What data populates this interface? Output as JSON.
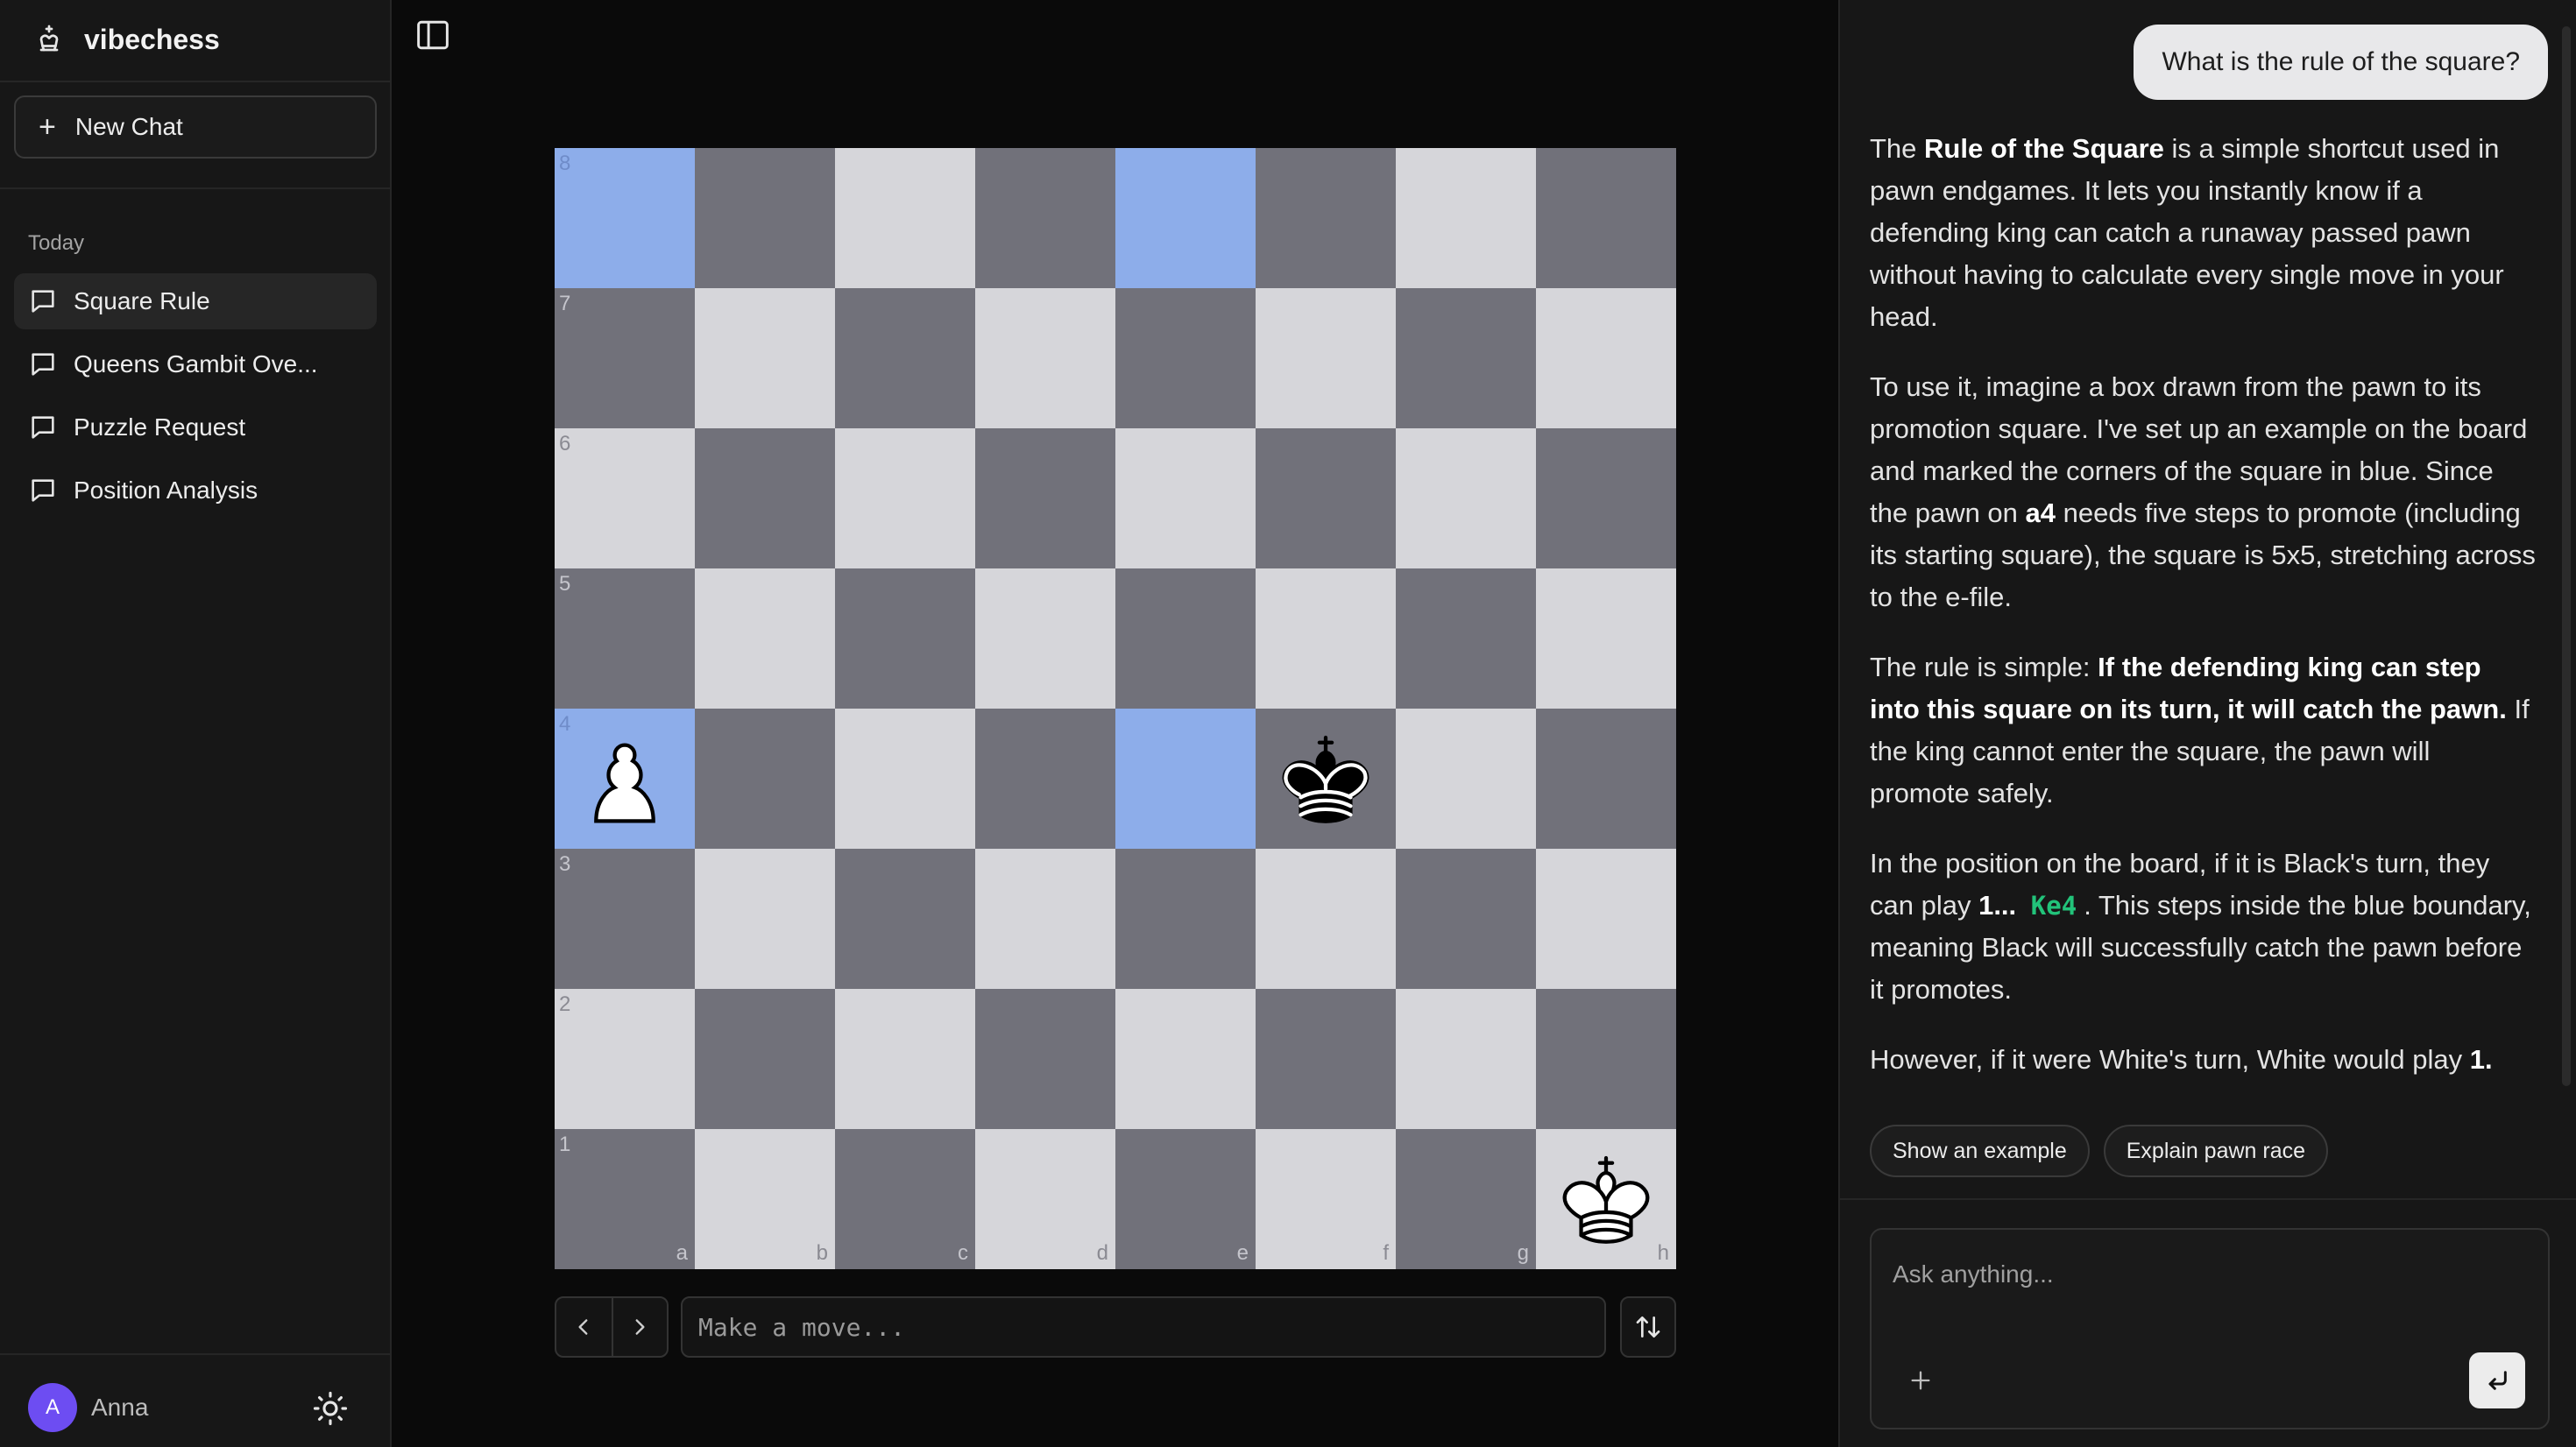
{
  "sidebar": {
    "brand": "vibechess",
    "new_chat": "New Chat",
    "section_label": "Today",
    "chats": [
      {
        "label": "Square Rule",
        "active": true
      },
      {
        "label": "Queens Gambit Ove...",
        "active": false
      },
      {
        "label": "Puzzle Request",
        "active": false
      },
      {
        "label": "Position Analysis",
        "active": false
      }
    ],
    "user": {
      "initial": "A",
      "name": "Anna"
    }
  },
  "board": {
    "files": [
      "a",
      "b",
      "c",
      "d",
      "e",
      "f",
      "g",
      "h"
    ],
    "ranks": [
      "8",
      "7",
      "6",
      "5",
      "4",
      "3",
      "2",
      "1"
    ],
    "highlighted": [
      "a8",
      "e8",
      "a4",
      "e4"
    ],
    "pieces": [
      {
        "square": "a4",
        "piece": "white-pawn"
      },
      {
        "square": "f4",
        "piece": "black-king"
      },
      {
        "square": "h1",
        "piece": "white-king"
      }
    ],
    "colors": {
      "light": "#d6d6da",
      "dark": "#71717a",
      "highlight": "#8dadea"
    }
  },
  "controls": {
    "move_placeholder": "Make a move..."
  },
  "chat": {
    "user_question": "What is the rule of the square?",
    "p1_pre": "The ",
    "p1_bold": "Rule of the Square",
    "p1_post": " is a simple shortcut used in pawn endgames. It lets you instantly know if a defending king can catch a runaway passed pawn without having to calculate every single move in your head.",
    "p2_pre": "To use it, imagine a box drawn from the pawn to its promotion square. I've set up an example on the board and marked the corners of the square in blue. Since the pawn on ",
    "p2_bold": "a4",
    "p2_post": " needs five steps to promote (including its starting square), the square is 5x5, stretching across to the e-file.",
    "p3_pre": "The rule is simple: ",
    "p3_bold": "If the defending king can step into this square on its turn, it will catch the pawn.",
    "p3_post": " If the king cannot enter the square, the pawn will promote safely.",
    "p4_pre": "In the position on the board, if it is Black's turn, they can play ",
    "p4_bold": "1...",
    "p4_move": "Ke4",
    "p4_post": ". This steps inside the blue boundary, meaning Black will successfully catch the pawn before it promotes.",
    "p5_pre": "However, if it were White's turn, White would play ",
    "p5_bold": "1.",
    "suggestions": [
      "Show an example",
      "Explain pawn race"
    ],
    "input_placeholder": "Ask anything...",
    "move_color": "#22c37a"
  }
}
